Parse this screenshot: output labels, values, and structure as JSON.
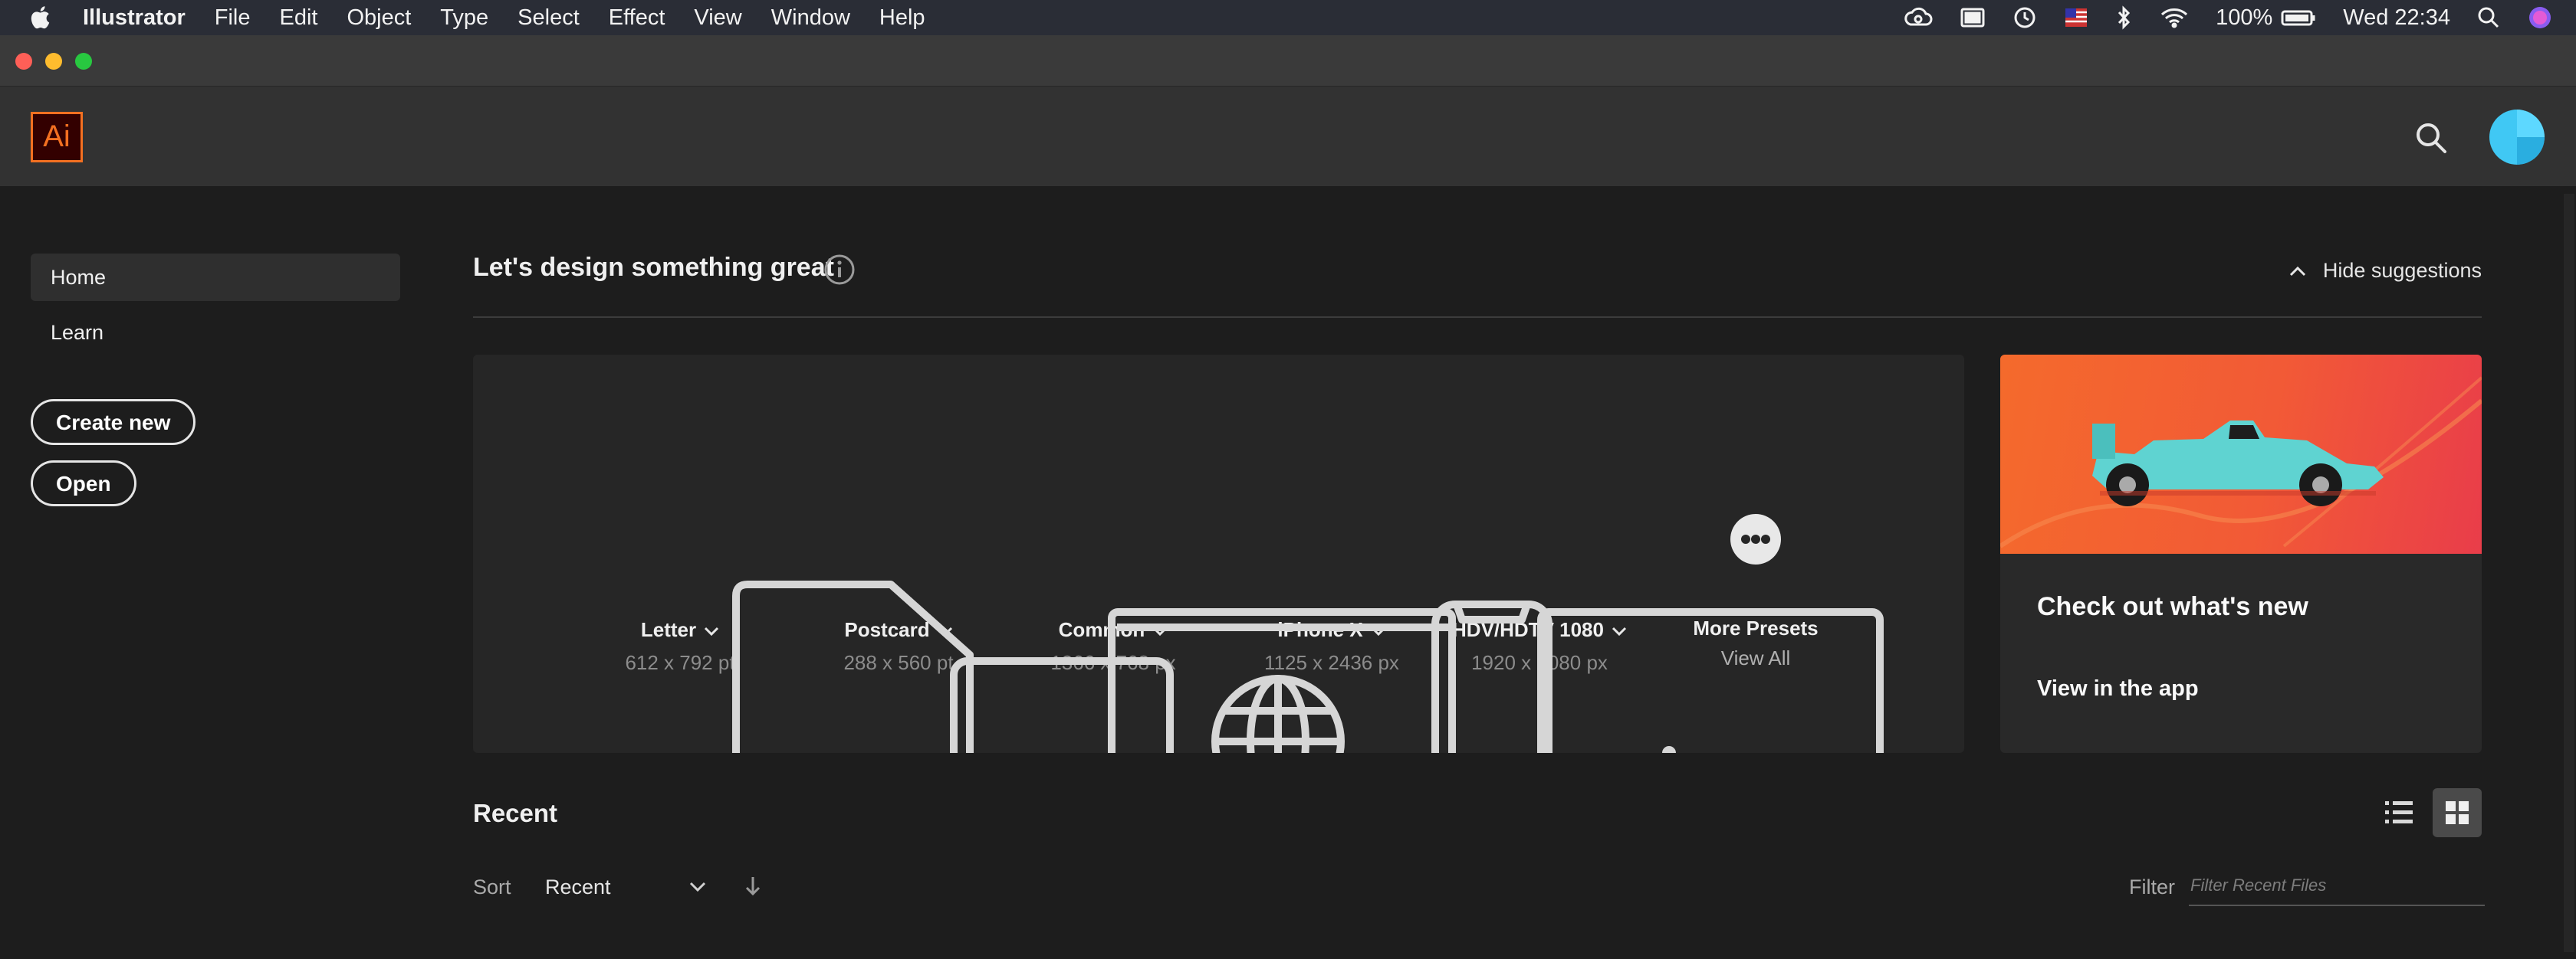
{
  "menubar": {
    "app_name": "Illustrator",
    "items": [
      "File",
      "Edit",
      "Object",
      "Type",
      "Select",
      "Effect",
      "View",
      "Window",
      "Help"
    ],
    "battery": "100%",
    "clock": "Wed 22:34"
  },
  "header": {
    "logo_text": "Ai"
  },
  "sidebar": {
    "items": [
      {
        "label": "Home",
        "active": true
      },
      {
        "label": "Learn",
        "active": false
      }
    ],
    "create_new_label": "Create new",
    "open_label": "Open"
  },
  "main": {
    "headline": "Let's design something great",
    "hide_suggestions_label": "Hide suggestions",
    "presets": [
      {
        "name": "Letter",
        "dims": "612 x 792 pt"
      },
      {
        "name": "Postcard",
        "dims": "288 x 560 pt"
      },
      {
        "name": "Common",
        "dims": "1366 x 768 px"
      },
      {
        "name": "iPhone X",
        "dims": "1125 x 2436 px"
      },
      {
        "name": "HDV/HDTV 1080",
        "dims": "1920 x 1080 px"
      },
      {
        "name": "More Presets",
        "dims": "View All"
      }
    ],
    "whats_new": {
      "title": "Check out what's new",
      "link": "View in the app"
    },
    "recent": {
      "title": "Recent",
      "sort_label": "Sort",
      "sort_value": "Recent",
      "filter_label": "Filter",
      "filter_placeholder": "Filter Recent Files"
    }
  },
  "colors": {
    "accent": "#f37021",
    "avatar": "#40c8f4",
    "banner": "#f25a36"
  }
}
